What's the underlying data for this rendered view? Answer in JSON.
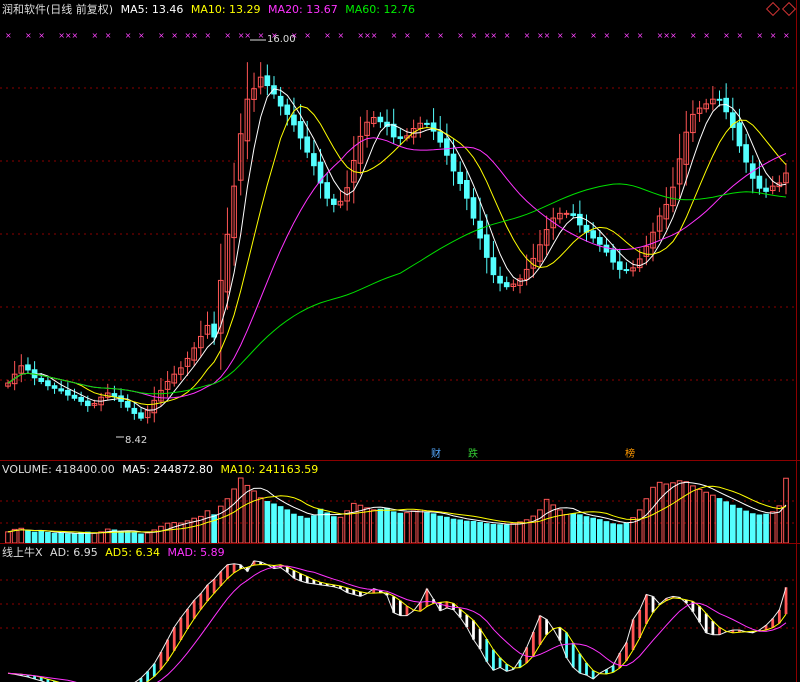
{
  "header": {
    "title": "润和软件(日线 前复权)",
    "ma5_label": "MA5:",
    "ma5_value": "13.46",
    "ma10_label": "MA10:",
    "ma10_value": "13.29",
    "ma20_label": "MA20:",
    "ma20_value": "13.67",
    "ma60_label": "MA60:",
    "ma60_value": "12.76"
  },
  "volume_header": {
    "label": "VOLUME:",
    "value": "418400.00",
    "ma5_label": "MA5:",
    "ma5_value": "244872.80",
    "ma10_label": "MA10:",
    "ma10_value": "241163.59"
  },
  "indicator_header": {
    "name": "线上牛X",
    "ad_label": "AD:",
    "ad_value": "6.95",
    "ad5_label": "AD5:",
    "ad5_value": "6.34",
    "mad_label": "MAD:",
    "mad_value": "5.89"
  },
  "annotations": {
    "high_label": "16.00",
    "low_label": "8.42",
    "event_cai": "财",
    "event_die": "跌",
    "event_bang": "榜"
  },
  "colors": {
    "up": "#ff5555",
    "down": "#54ffff",
    "ma5": "#ffffff",
    "ma10": "#ffff00",
    "ma20": "#ff33ff",
    "ma60": "#00e000",
    "grid": "#8b0000",
    "marker": "#ff44ff"
  },
  "chart_data": {
    "type": "candlestick",
    "close": [
      9.45,
      9.62,
      9.78,
      9.7,
      9.55,
      9.48,
      9.4,
      9.35,
      9.3,
      9.22,
      9.16,
      9.1,
      9.02,
      9.06,
      9.18,
      9.26,
      9.19,
      9.1,
      8.99,
      8.87,
      8.78,
      8.93,
      9.12,
      9.31,
      9.48,
      9.62,
      9.74,
      9.92,
      10.12,
      10.34,
      10.55,
      10.33,
      11.41,
      12.29,
      13.21,
      14.21,
      14.87,
      15.07,
      15.29,
      15.13,
      14.97,
      14.74,
      14.58,
      14.38,
      14.13,
      13.86,
      13.6,
      13.27,
      12.98,
      12.86,
      12.92,
      13.18,
      13.7,
      14.16,
      14.43,
      14.52,
      14.44,
      14.35,
      14.15,
      14.12,
      14.17,
      14.31,
      14.41,
      14.4,
      14.26,
      14.05,
      13.8,
      13.5,
      13.26,
      12.98,
      12.6,
      12.22,
      11.85,
      11.52,
      11.36,
      11.29,
      11.34,
      11.44,
      11.62,
      11.83,
      12.09,
      12.38,
      12.6,
      12.69,
      12.69,
      12.65,
      12.47,
      12.33,
      12.22,
      12.1,
      11.95,
      11.76,
      11.62,
      11.6,
      11.65,
      11.82,
      12.06,
      12.33,
      12.64,
      12.86,
      13.19,
      13.73,
      14.24,
      14.58,
      14.7,
      14.78,
      14.87,
      14.86,
      14.63,
      14.33,
      13.98,
      13.67,
      13.36,
      13.17,
      13.11,
      13.21,
      13.27,
      13.46
    ],
    "volume": [
      72000,
      88000,
      95000,
      78000,
      70000,
      76000,
      68000,
      62000,
      64000,
      60000,
      58000,
      66000,
      70000,
      63000,
      72000,
      90000,
      84000,
      76000,
      74000,
      67000,
      58000,
      65000,
      84000,
      108000,
      128000,
      132000,
      129000,
      143000,
      160000,
      172000,
      208000,
      182000,
      238000,
      286000,
      349000,
      420000,
      372000,
      336000,
      292000,
      268000,
      252000,
      235000,
      214000,
      186000,
      172000,
      160000,
      176000,
      218000,
      194000,
      170000,
      166000,
      208000,
      256000,
      244000,
      227000,
      214000,
      218000,
      224000,
      201000,
      192000,
      196000,
      207000,
      213000,
      196000,
      188000,
      173000,
      166000,
      154000,
      149000,
      141000,
      139000,
      133000,
      125000,
      120000,
      118000,
      116000,
      125000,
      136000,
      150000,
      174000,
      214000,
      282000,
      246000,
      214000,
      184000,
      188000,
      182000,
      170000,
      160000,
      151000,
      138000,
      124000,
      118000,
      126000,
      164000,
      214000,
      286000,
      360000,
      392000,
      381000,
      389000,
      402000,
      396000,
      369000,
      346000,
      328000,
      309000,
      287000,
      266000,
      244000,
      224000,
      206000,
      189000,
      181000,
      186000,
      202000,
      240000,
      418400
    ],
    "ad": [
      -2.0,
      -2.1,
      -2.25,
      -2.4,
      -2.6,
      -2.8,
      -3.05,
      -3.2,
      -3.4,
      -3.55,
      -3.7,
      -3.85,
      -4.0,
      -4.1,
      -4.1,
      -4.0,
      -3.9,
      -3.7,
      -3.4,
      -3.0,
      -2.5,
      -1.8,
      -1.0,
      0.2,
      1.5,
      2.8,
      3.8,
      4.7,
      5.6,
      6.3,
      7.2,
      7.8,
      8.6,
      9.3,
      9.4,
      9.3,
      8.6,
      9.7,
      9.6,
      9.3,
      8.9,
      9.0,
      8.5,
      7.9,
      7.6,
      7.4,
      7.3,
      7.2,
      7.1,
      7.0,
      6.8,
      6.4,
      6.2,
      6.0,
      6.3,
      6.8,
      6.6,
      6.1,
      4.3,
      4.0,
      4.0,
      4.5,
      5.4,
      6.8,
      5.7,
      4.5,
      4.8,
      4.6,
      3.8,
      2.8,
      1.5,
      0.5,
      -0.8,
      -1.7,
      -1.4,
      -1.8,
      -1.6,
      -0.6,
      0.7,
      2.3,
      4.0,
      3.6,
      2.6,
      1.4,
      -0.4,
      -1.4,
      -2.0,
      -2.2,
      -2.6,
      -2.0,
      -1.6,
      -1.2,
      0.1,
      1.2,
      3.6,
      4.6,
      6.2,
      6.0,
      5.2,
      5.8,
      6.0,
      5.9,
      5.3,
      4.4,
      3.3,
      2.2,
      2.0,
      2.0,
      2.3,
      2.5,
      2.5,
      2.3,
      2.2,
      2.5,
      3.0,
      3.7,
      4.6,
      6.95
    ],
    "ylim": [
      8.42,
      16.0
    ],
    "price_high_marker": 16.0,
    "price_low_marker": 8.42,
    "ma_latest": {
      "MA5": 13.46,
      "MA10": 13.29,
      "MA20": 13.67,
      "MA60": 12.76
    }
  }
}
